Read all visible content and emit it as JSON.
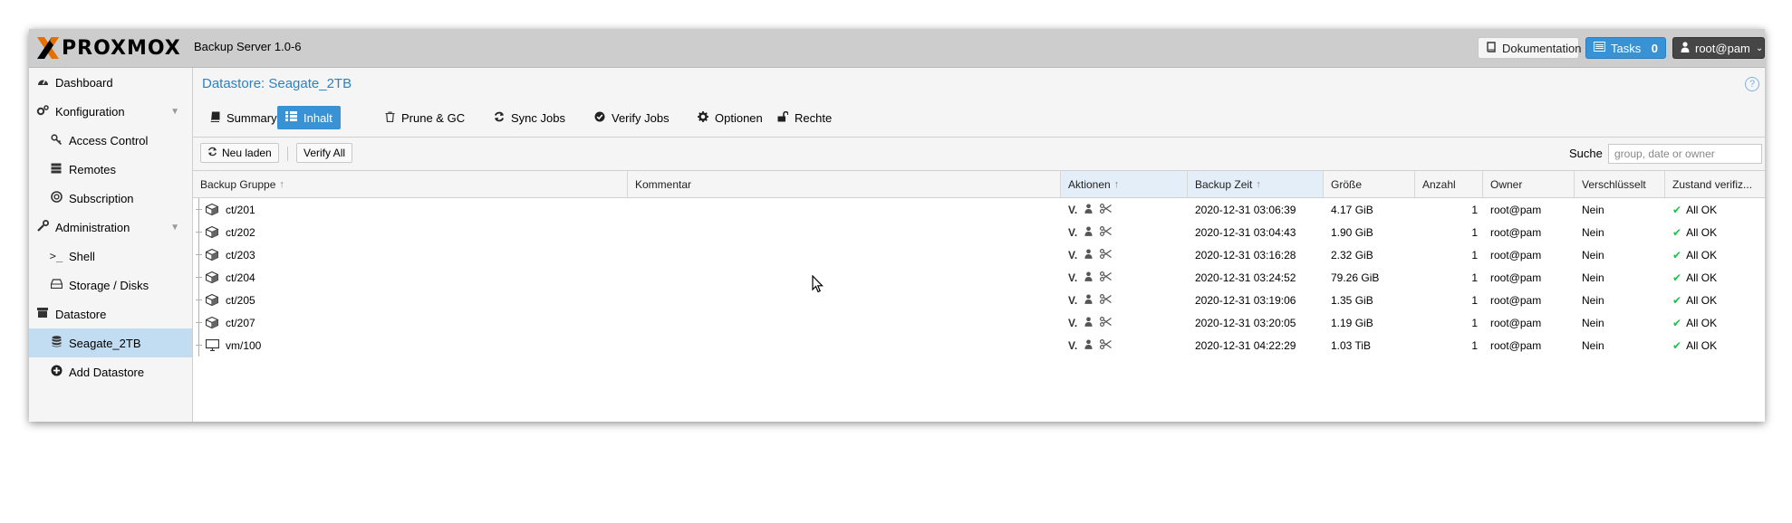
{
  "header": {
    "logo_text": "PROXMOX",
    "product": "Backup Server 1.0-6",
    "docs_label": "Dokumentation",
    "tasks_label": "Tasks",
    "tasks_count": "0",
    "user_label": "root@pam"
  },
  "sidebar": {
    "items": [
      {
        "label": "Dashboard",
        "icon": "dashboard-icon"
      },
      {
        "label": "Konfiguration",
        "icon": "cogs-icon"
      },
      {
        "label": "Access Control",
        "icon": "key-icon"
      },
      {
        "label": "Remotes",
        "icon": "server-icon"
      },
      {
        "label": "Subscription",
        "icon": "support-icon"
      },
      {
        "label": "Administration",
        "icon": "wrench-icon"
      },
      {
        "label": "Shell",
        "icon": "terminal-icon"
      },
      {
        "label": "Storage / Disks",
        "icon": "hdd-icon"
      },
      {
        "label": "Datastore",
        "icon": "archive-icon"
      },
      {
        "label": "Seagate_2TB",
        "icon": "database-icon"
      },
      {
        "label": "Add Datastore",
        "icon": "plus-circle-icon"
      }
    ]
  },
  "main": {
    "title": "Datastore: Seagate_2TB",
    "help_glyph": "?",
    "tabs": [
      {
        "label": "Summary",
        "icon": "book-icon"
      },
      {
        "label": "Inhalt",
        "icon": "grid-icon"
      },
      {
        "label": "Prune & GC",
        "icon": "trash-icon"
      },
      {
        "label": "Sync Jobs",
        "icon": "refresh-icon"
      },
      {
        "label": "Verify Jobs",
        "icon": "check-circle-icon"
      },
      {
        "label": "Optionen",
        "icon": "gear-icon"
      },
      {
        "label": "Rechte",
        "icon": "unlock-icon"
      }
    ],
    "toolbar": {
      "reload_label": "Neu laden",
      "verify_all_label": "Verify All",
      "search_label": "Suche",
      "search_placeholder": "group, date or owner"
    },
    "columns": [
      "Backup Gruppe",
      "Kommentar",
      "Aktionen",
      "Backup Zeit",
      "Größe",
      "Anzahl",
      "Owner",
      "Verschlüsselt",
      "Zustand verifiz..."
    ],
    "rows": [
      {
        "group": "ct/201",
        "type": "ct",
        "action_v": "V.",
        "time": "2020-12-31 03:06:39",
        "size": "4.17 GiB",
        "count": "1",
        "owner": "root@pam",
        "encrypted": "Nein",
        "verify": "All OK"
      },
      {
        "group": "ct/202",
        "type": "ct",
        "action_v": "V.",
        "time": "2020-12-31 03:04:43",
        "size": "1.90 GiB",
        "count": "1",
        "owner": "root@pam",
        "encrypted": "Nein",
        "verify": "All OK"
      },
      {
        "group": "ct/203",
        "type": "ct",
        "action_v": "V.",
        "time": "2020-12-31 03:16:28",
        "size": "2.32 GiB",
        "count": "1",
        "owner": "root@pam",
        "encrypted": "Nein",
        "verify": "All OK"
      },
      {
        "group": "ct/204",
        "type": "ct",
        "action_v": "V.",
        "time": "2020-12-31 03:24:52",
        "size": "79.26 GiB",
        "count": "1",
        "owner": "root@pam",
        "encrypted": "Nein",
        "verify": "All OK"
      },
      {
        "group": "ct/205",
        "type": "ct",
        "action_v": "V.",
        "time": "2020-12-31 03:19:06",
        "size": "1.35 GiB",
        "count": "1",
        "owner": "root@pam",
        "encrypted": "Nein",
        "verify": "All OK"
      },
      {
        "group": "ct/207",
        "type": "ct",
        "action_v": "V.",
        "time": "2020-12-31 03:20:05",
        "size": "1.19 GiB",
        "count": "1",
        "owner": "root@pam",
        "encrypted": "Nein",
        "verify": "All OK"
      },
      {
        "group": "vm/100",
        "type": "vm",
        "action_v": "V.",
        "time": "2020-12-31 04:22:29",
        "size": "1.03 TiB",
        "count": "1",
        "owner": "root@pam",
        "encrypted": "Nein",
        "verify": "All OK"
      }
    ]
  },
  "colors": {
    "accent": "#3892d4",
    "title": "#2b82c3",
    "selected": "#c2ddf2",
    "ok": "#21bf4b",
    "logo_orange": "#e57000"
  }
}
